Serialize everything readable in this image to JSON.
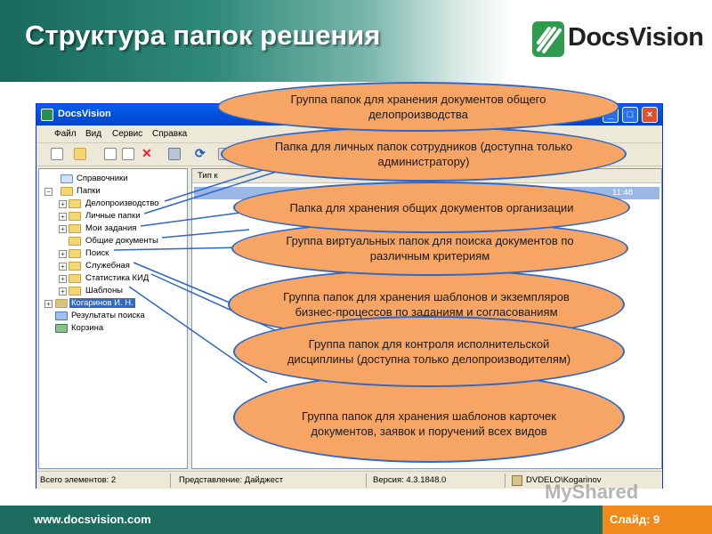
{
  "slide": {
    "title": "Структура папок решения",
    "logo_text": "DocsVision",
    "footer_url": "www.docsvision.com",
    "slide_number": "Слайд: 9",
    "watermark": "MyShared"
  },
  "window": {
    "title": "DocsVision",
    "menu": [
      "Файл",
      "Вид",
      "Сервис",
      "Справка"
    ],
    "tree": [
      {
        "label": "Справочники",
        "level": 0
      },
      {
        "label": "Папки",
        "level": 0,
        "expanded": true
      },
      {
        "label": "Делопроизводство",
        "level": 1
      },
      {
        "label": "Личные папки",
        "level": 1
      },
      {
        "label": "Мои задания",
        "level": 1
      },
      {
        "label": "Общие документы",
        "level": 1
      },
      {
        "label": "Поиск",
        "level": 1
      },
      {
        "label": "Служебная",
        "level": 1
      },
      {
        "label": "Статистика КИД",
        "level": 1
      },
      {
        "label": "Шаблоны",
        "level": 1
      },
      {
        "label": "Когаринов И. Н.",
        "level": 0,
        "selected": true
      },
      {
        "label": "Результаты поиска",
        "level": 0
      },
      {
        "label": "Корзина",
        "level": 0
      }
    ],
    "list_header": "Тип к",
    "list_row_time": "11:48",
    "status": {
      "total": "Всего элементов: 2",
      "view": "Представление: Дайджест",
      "version": "Версия: 4.3.1848.0",
      "user": "DVDELO\\Kogarinov"
    }
  },
  "callouts": [
    "Группа папок для хранения документов общего делопроизводства",
    "Папка для личных папок сотрудников (доступна только администратору)",
    "Папка для хранения общих документов организации",
    "Группа виртуальных папок для поиска документов по различным критериям",
    "Группа папок для хранения шаблонов и экземпляров бизнес-процессов по заданиям и согласованиям",
    "Группа папок для контроля исполнительской дисциплины (доступна только делопроизводителям)",
    "Группа папок для хранения шаблонов карточек документов, заявок и поручений всех видов"
  ],
  "colors": {
    "header_teal": "#17695c",
    "footer_orange": "#f08a1c",
    "callout_fill": "#f6a565",
    "callout_border": "#2f67c7"
  }
}
